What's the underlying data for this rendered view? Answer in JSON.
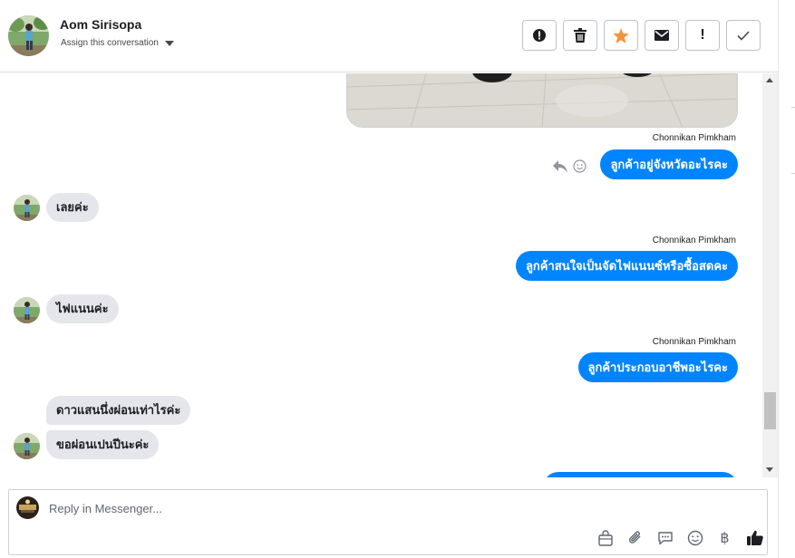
{
  "contact": {
    "name": "Aom Sirisopa",
    "assign_label": "Assign this conversation"
  },
  "header_actions": [
    {
      "icon": "alert-circle-icon"
    },
    {
      "icon": "trash-icon"
    },
    {
      "icon": "star-icon",
      "color": "#f7923a"
    },
    {
      "icon": "envelope-icon"
    },
    {
      "icon": "exclamation-icon",
      "text": "!"
    },
    {
      "icon": "checkmark-icon"
    }
  ],
  "messages": [
    {
      "dir": "out",
      "sender": "Chonnikan Pimkham",
      "text": "ลูกค้าอยู่จังหวัดอะไรคะ"
    },
    {
      "dir": "in",
      "text": "เลยค่ะ"
    },
    {
      "dir": "out",
      "sender": "Chonnikan Pimkham",
      "text": "ลูกค้าสนใจเป็นจัดไฟแนนซ์หรือซื้อสดคะ"
    },
    {
      "dir": "in",
      "text": "ไฟแนนค่ะ"
    },
    {
      "dir": "out",
      "sender": "Chonnikan Pimkham",
      "text": "ลูกค้าประกอบอาชีพอะไรคะ"
    },
    {
      "dir": "in",
      "text": "ดาวแสนนึ่งผ่อนเท่าไรค่ะ"
    },
    {
      "dir": "in",
      "text": "ขอผ่อนเปนปีนะค่ะ"
    }
  ],
  "composer": {
    "placeholder": "Reply in Messenger...",
    "tools": [
      "shopping-bag-icon",
      "paperclip-icon",
      "saved-reply-icon",
      "emoji-icon",
      "baht-icon",
      "thumbs-up-icon"
    ],
    "baht_symbol": "฿"
  },
  "colors": {
    "outgoing_bubble": "#0084ff",
    "incoming_bubble": "#e4e6eb",
    "accent_star": "#f7923a",
    "like": "#1c1e21"
  }
}
